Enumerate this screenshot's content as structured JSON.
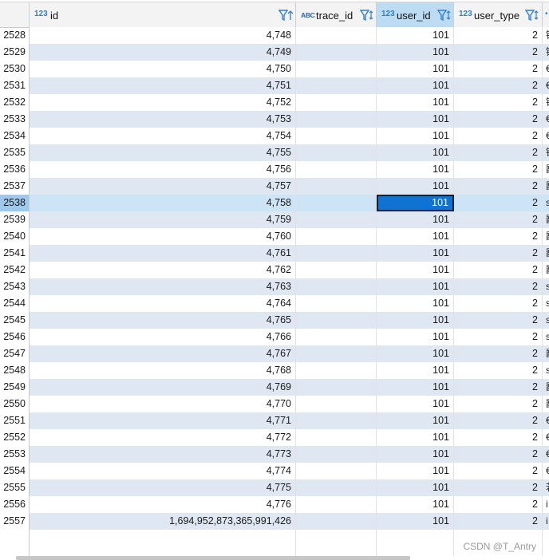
{
  "columns": [
    {
      "key": "id",
      "type": "123",
      "name": "id"
    },
    {
      "key": "trace_id",
      "type": "ABC",
      "name": "trace_id"
    },
    {
      "key": "user_id",
      "type": "123",
      "name": "user_id",
      "selected": true
    },
    {
      "key": "user_type",
      "type": "123",
      "name": "user_type"
    }
  ],
  "rows": [
    {
      "n": "2528",
      "id": "4,748",
      "trace_id": "",
      "user_id": "101",
      "user_type": "2",
      "cut": "锋"
    },
    {
      "n": "2529",
      "id": "4,749",
      "trace_id": "",
      "user_id": "101",
      "user_type": "2",
      "cut": "锋"
    },
    {
      "n": "2530",
      "id": "4,750",
      "trace_id": "",
      "user_id": "101",
      "user_type": "2",
      "cut": "€"
    },
    {
      "n": "2531",
      "id": "4,751",
      "trace_id": "",
      "user_id": "101",
      "user_type": "2",
      "cut": "€"
    },
    {
      "n": "2532",
      "id": "4,752",
      "trace_id": "",
      "user_id": "101",
      "user_type": "2",
      "cut": "锋"
    },
    {
      "n": "2533",
      "id": "4,753",
      "trace_id": "",
      "user_id": "101",
      "user_type": "2",
      "cut": "€"
    },
    {
      "n": "2534",
      "id": "4,754",
      "trace_id": "",
      "user_id": "101",
      "user_type": "2",
      "cut": "€"
    },
    {
      "n": "2535",
      "id": "4,755",
      "trace_id": "",
      "user_id": "101",
      "user_type": "2",
      "cut": "锋"
    },
    {
      "n": "2536",
      "id": "4,756",
      "trace_id": "",
      "user_id": "101",
      "user_type": "2",
      "cut": "鄙"
    },
    {
      "n": "2537",
      "id": "4,757",
      "trace_id": "",
      "user_id": "101",
      "user_type": "2",
      "cut": "鄙"
    },
    {
      "n": "2538",
      "id": "4,758",
      "trace_id": "",
      "user_id": "101",
      "user_type": "2",
      "cut": "s",
      "current": true
    },
    {
      "n": "2539",
      "id": "4,759",
      "trace_id": "",
      "user_id": "101",
      "user_type": "2",
      "cut": "鄙"
    },
    {
      "n": "2540",
      "id": "4,760",
      "trace_id": "",
      "user_id": "101",
      "user_type": "2",
      "cut": "鄙"
    },
    {
      "n": "2541",
      "id": "4,761",
      "trace_id": "",
      "user_id": "101",
      "user_type": "2",
      "cut": "鄙"
    },
    {
      "n": "2542",
      "id": "4,762",
      "trace_id": "",
      "user_id": "101",
      "user_type": "2",
      "cut": "鄙"
    },
    {
      "n": "2543",
      "id": "4,763",
      "trace_id": "",
      "user_id": "101",
      "user_type": "2",
      "cut": "s"
    },
    {
      "n": "2544",
      "id": "4,764",
      "trace_id": "",
      "user_id": "101",
      "user_type": "2",
      "cut": "s"
    },
    {
      "n": "2545",
      "id": "4,765",
      "trace_id": "",
      "user_id": "101",
      "user_type": "2",
      "cut": "s"
    },
    {
      "n": "2546",
      "id": "4,766",
      "trace_id": "",
      "user_id": "101",
      "user_type": "2",
      "cut": "s"
    },
    {
      "n": "2547",
      "id": "4,767",
      "trace_id": "",
      "user_id": "101",
      "user_type": "2",
      "cut": "鄙"
    },
    {
      "n": "2548",
      "id": "4,768",
      "trace_id": "",
      "user_id": "101",
      "user_type": "2",
      "cut": "s"
    },
    {
      "n": "2549",
      "id": "4,769",
      "trace_id": "",
      "user_id": "101",
      "user_type": "2",
      "cut": "鄙"
    },
    {
      "n": "2550",
      "id": "4,770",
      "trace_id": "",
      "user_id": "101",
      "user_type": "2",
      "cut": "鄙"
    },
    {
      "n": "2551",
      "id": "4,771",
      "trace_id": "",
      "user_id": "101",
      "user_type": "2",
      "cut": "€"
    },
    {
      "n": "2552",
      "id": "4,772",
      "trace_id": "",
      "user_id": "101",
      "user_type": "2",
      "cut": "€"
    },
    {
      "n": "2553",
      "id": "4,773",
      "trace_id": "",
      "user_id": "101",
      "user_type": "2",
      "cut": "€"
    },
    {
      "n": "2554",
      "id": "4,774",
      "trace_id": "",
      "user_id": "101",
      "user_type": "2",
      "cut": "€"
    },
    {
      "n": "2555",
      "id": "4,775",
      "trace_id": "",
      "user_id": "101",
      "user_type": "2",
      "cut": "若"
    },
    {
      "n": "2556",
      "id": "4,776",
      "trace_id": "",
      "user_id": "101",
      "user_type": "2",
      "cut": "i"
    },
    {
      "n": "2557",
      "id": "1,694,952,873,365,991,426",
      "trace_id": "",
      "user_id": "101",
      "user_type": "2",
      "cut": "i"
    }
  ],
  "watermark": "CSDN @T_Antry",
  "colors": {
    "header_bg": "#f3f3f3",
    "selected_header": "#bcdcf4",
    "row_alt": "#dfe7f2",
    "current_row": "#cde3f6",
    "selected_cell": "#0f73d4"
  },
  "icons": {
    "type_numeric": "123",
    "type_text": "ABC",
    "filter": "filter-sort-icon"
  }
}
